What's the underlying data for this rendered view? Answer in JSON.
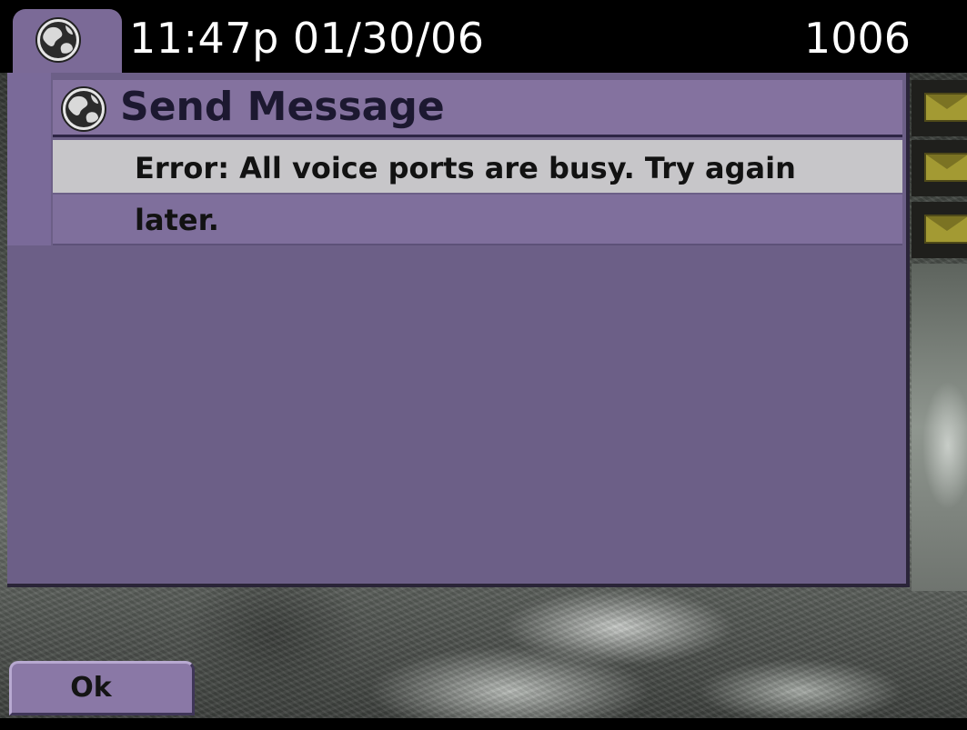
{
  "status_bar": {
    "time_date": "11:47p 01/30/06",
    "extension": "1006",
    "icon": "globe-icon"
  },
  "dialog": {
    "title": "Send Message",
    "title_icon": "globe-icon",
    "message_line1": "Error: All voice ports are busy. Try again",
    "message_line2": "later."
  },
  "side_icons": [
    "envelope-icon",
    "envelope-icon",
    "envelope-icon"
  ],
  "softkeys": {
    "ok_label": "Ok"
  },
  "colors": {
    "panel": "#6c5f87",
    "title_bar": "#84729f",
    "selected_row": "#c7c6c9",
    "envelope": "#a39a33"
  }
}
